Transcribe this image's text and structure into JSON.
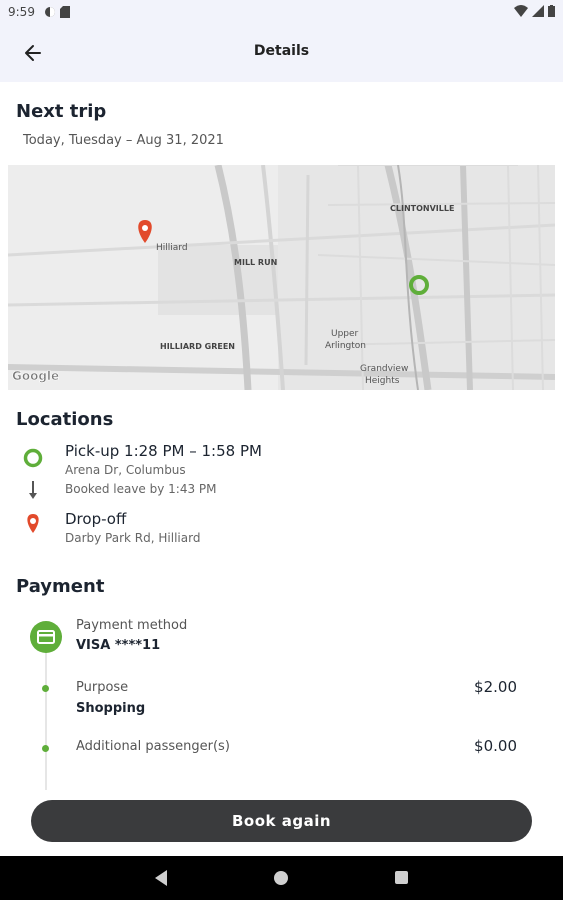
{
  "status_bar": {
    "time": "9:59"
  },
  "app_bar": {
    "title": "Details"
  },
  "trip": {
    "heading": "Next trip",
    "date": "Today, Tuesday – Aug 31, 2021"
  },
  "map": {
    "labels": {
      "hilliard": "Hilliard",
      "clintonville": "CLINTONVILLE",
      "mill_run": "MILL RUN",
      "upper": "Upper",
      "arlington": "Arlington",
      "hilliard_green": "HILLIARD GREEN",
      "grandview": "Grandview",
      "heights": "Heights",
      "google": "Google"
    }
  },
  "locations": {
    "heading": "Locations",
    "pickup_title": "Pick-up 1:28 PM – 1:58 PM",
    "pickup_address": "Arena Dr, Columbus",
    "booked_leave": "Booked leave by 1:43 PM",
    "dropoff_title": "Drop-off",
    "dropoff_address": "Darby Park Rd, Hilliard"
  },
  "payment": {
    "heading": "Payment",
    "method_label": "Payment method",
    "method_value": "VISA ****11",
    "purpose_label": "Purpose",
    "purpose_value": "Shopping",
    "purpose_amount": "$2.00",
    "passengers_label": "Additional passenger(s)",
    "passengers_amount": "$0.00"
  },
  "actions": {
    "book_again": "Book again"
  },
  "colors": {
    "accent_green": "#5fae3a",
    "pin_red": "#e24a2b",
    "button_dark": "#3a3b3d",
    "header_bg": "#f2f3fb"
  }
}
